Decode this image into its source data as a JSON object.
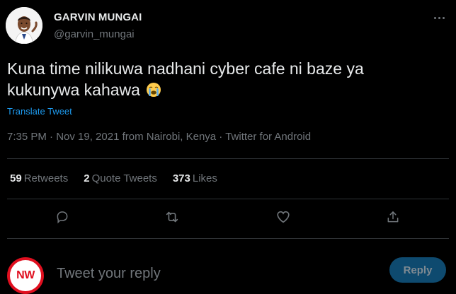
{
  "author": {
    "name": "GARVIN MUNGAI",
    "handle": "@garvin_mungai"
  },
  "tweet": {
    "text": "Kuna time nilikuwa nadhani cyber cafe ni baze ya kukunywa kahawa",
    "emoji": "crying-face-emoji",
    "translate_label": "Translate Tweet",
    "meta": "7:35 PM · Nov 19, 2021 from Nairobi, Kenya · Twitter for Android"
  },
  "stats": {
    "retweets_count": "59",
    "retweets_label": "Retweets",
    "quote_tweets_count": "2",
    "quote_tweets_label": "Quote Tweets",
    "likes_count": "373",
    "likes_label": "Likes"
  },
  "actions": {
    "icons": [
      "reply-icon",
      "retweet-icon",
      "like-icon",
      "share-icon"
    ]
  },
  "reply": {
    "avatar_text": "NW",
    "placeholder": "Tweet your reply",
    "button_label": "Reply"
  },
  "colors": {
    "background": "#000000",
    "accent": "#1d9bf0",
    "muted": "#71767b",
    "divider": "#2f3336",
    "reply_button_bg": "#0e4a6f"
  }
}
